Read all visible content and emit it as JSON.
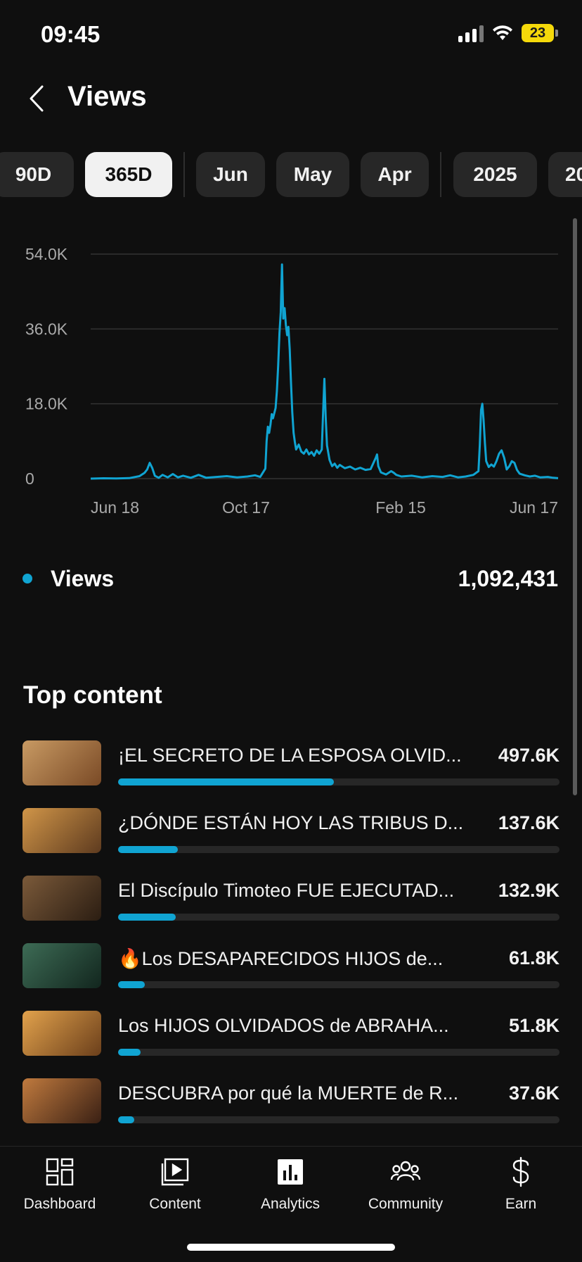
{
  "status_bar": {
    "time": "09:45",
    "battery": "23"
  },
  "header": {
    "title": "Views",
    "back_icon": "chevron-left-icon"
  },
  "chips": [
    {
      "label": "90D",
      "selected": false
    },
    {
      "label": "365D",
      "selected": true
    },
    {
      "label": "Jun",
      "selected": false
    },
    {
      "label": "May",
      "selected": false
    },
    {
      "label": "Apr",
      "selected": false
    },
    {
      "label": "2025",
      "selected": false
    },
    {
      "label": "20",
      "selected": false
    }
  ],
  "chart_data": {
    "type": "line",
    "title": "",
    "xlabel": "",
    "ylabel": "",
    "y_tick_labels": [
      "54.0K",
      "36.0K",
      "18.0K",
      "0"
    ],
    "x_tick_labels": [
      "Jun 18",
      "Oct 17",
      "Feb 15",
      "Jun 17"
    ],
    "ylim": [
      0,
      54000
    ],
    "grid": true,
    "color": "#10a4d2",
    "x_unit": "days from Jun 18",
    "points": [
      [
        0,
        0
      ],
      [
        10,
        80
      ],
      [
        20,
        50
      ],
      [
        30,
        120
      ],
      [
        38,
        600
      ],
      [
        42,
        1400
      ],
      [
        44,
        2200
      ],
      [
        46,
        3800
      ],
      [
        48,
        2500
      ],
      [
        50,
        700
      ],
      [
        53,
        200
      ],
      [
        56,
        900
      ],
      [
        60,
        300
      ],
      [
        64,
        1100
      ],
      [
        68,
        300
      ],
      [
        72,
        700
      ],
      [
        78,
        200
      ],
      [
        84,
        900
      ],
      [
        90,
        200
      ],
      [
        98,
        400
      ],
      [
        106,
        600
      ],
      [
        114,
        300
      ],
      [
        122,
        500
      ],
      [
        128,
        800
      ],
      [
        132,
        400
      ],
      [
        136,
        2400
      ],
      [
        137,
        9000
      ],
      [
        138,
        12500
      ],
      [
        139,
        11000
      ],
      [
        140,
        13000
      ],
      [
        141,
        15500
      ],
      [
        142,
        14500
      ],
      [
        144,
        17000
      ],
      [
        145,
        21000
      ],
      [
        146,
        27000
      ],
      [
        147,
        35000
      ],
      [
        148,
        40000
      ],
      [
        149,
        51500
      ],
      [
        150,
        38500
      ],
      [
        151,
        41000
      ],
      [
        152,
        37000
      ],
      [
        153,
        34500
      ],
      [
        154,
        36500
      ],
      [
        155,
        31000
      ],
      [
        156,
        23000
      ],
      [
        157,
        16000
      ],
      [
        158,
        11000
      ],
      [
        159,
        8800
      ],
      [
        160,
        7000
      ],
      [
        162,
        8200
      ],
      [
        164,
        6500
      ],
      [
        166,
        6000
      ],
      [
        168,
        7000
      ],
      [
        170,
        5800
      ],
      [
        172,
        6400
      ],
      [
        174,
        5500
      ],
      [
        176,
        6800
      ],
      [
        178,
        6000
      ],
      [
        180,
        7000
      ],
      [
        181,
        16000
      ],
      [
        182,
        24000
      ],
      [
        183,
        15000
      ],
      [
        184,
        8000
      ],
      [
        186,
        4500
      ],
      [
        188,
        3000
      ],
      [
        190,
        3600
      ],
      [
        192,
        2600
      ],
      [
        194,
        3300
      ],
      [
        198,
        2500
      ],
      [
        202,
        2900
      ],
      [
        206,
        2200
      ],
      [
        210,
        2600
      ],
      [
        214,
        2100
      ],
      [
        218,
        2300
      ],
      [
        222,
        5000
      ],
      [
        223,
        5800
      ],
      [
        224,
        3000
      ],
      [
        226,
        1500
      ],
      [
        230,
        1000
      ],
      [
        234,
        1800
      ],
      [
        236,
        1400
      ],
      [
        238,
        900
      ],
      [
        242,
        500
      ],
      [
        250,
        700
      ],
      [
        258,
        300
      ],
      [
        266,
        600
      ],
      [
        274,
        400
      ],
      [
        280,
        800
      ],
      [
        286,
        300
      ],
      [
        292,
        500
      ],
      [
        298,
        900
      ],
      [
        302,
        1800
      ],
      [
        303,
        8000
      ],
      [
        304,
        16500
      ],
      [
        305,
        18000
      ],
      [
        306,
        14000
      ],
      [
        307,
        8500
      ],
      [
        308,
        4200
      ],
      [
        310,
        2800
      ],
      [
        312,
        3400
      ],
      [
        314,
        2900
      ],
      [
        316,
        4200
      ],
      [
        318,
        6000
      ],
      [
        320,
        6800
      ],
      [
        322,
        5000
      ],
      [
        324,
        2200
      ],
      [
        326,
        3000
      ],
      [
        328,
        4200
      ],
      [
        330,
        3800
      ],
      [
        332,
        2100
      ],
      [
        334,
        1200
      ],
      [
        338,
        800
      ],
      [
        342,
        500
      ],
      [
        346,
        700
      ],
      [
        350,
        300
      ],
      [
        356,
        400
      ],
      [
        360,
        200
      ],
      [
        364,
        100
      ]
    ],
    "x_max": 364,
    "legend": {
      "label": "Views",
      "total": "1,092,431"
    }
  },
  "top_content": {
    "title": "Top content",
    "items": [
      {
        "title": "¡EL SECRETO DE LA ESPOSA OLVID...",
        "value": "497.6K",
        "fraction": 1.0,
        "thumb_colors": [
          "#c89a63",
          "#7a4a26"
        ]
      },
      {
        "title": "¿DÓNDE ESTÁN HOY LAS TRIBUS D...",
        "value": "137.6K",
        "fraction": 0.276,
        "thumb_colors": [
          "#d09548",
          "#5e3b1f"
        ]
      },
      {
        "title": "El Discípulo Timoteo FUE EJECUTAD...",
        "value": "132.9K",
        "fraction": 0.267,
        "thumb_colors": [
          "#7b5a3a",
          "#2b1d12"
        ]
      },
      {
        "title": "🔥Los DESAPARECIDOS HIJOS de...",
        "value": "61.8K",
        "fraction": 0.124,
        "thumb_colors": [
          "#3d6b55",
          "#12261e"
        ]
      },
      {
        "title": "Los HIJOS OLVIDADOS de ABRAHA...",
        "value": "51.8K",
        "fraction": 0.104,
        "thumb_colors": [
          "#e2a24c",
          "#6b3f1b"
        ]
      },
      {
        "title": "DESCUBRA por qué la MUERTE de R...",
        "value": "37.6K",
        "fraction": 0.076,
        "thumb_colors": [
          "#c07a3e",
          "#3a2014"
        ]
      }
    ]
  },
  "bottom_nav": [
    {
      "label": "Dashboard",
      "icon": "dashboard-icon",
      "active": false
    },
    {
      "label": "Content",
      "icon": "content-icon",
      "active": false
    },
    {
      "label": "Analytics",
      "icon": "analytics-icon",
      "active": true
    },
    {
      "label": "Community",
      "icon": "community-icon",
      "active": false
    },
    {
      "label": "Earn",
      "icon": "dollar-icon",
      "active": false
    }
  ]
}
